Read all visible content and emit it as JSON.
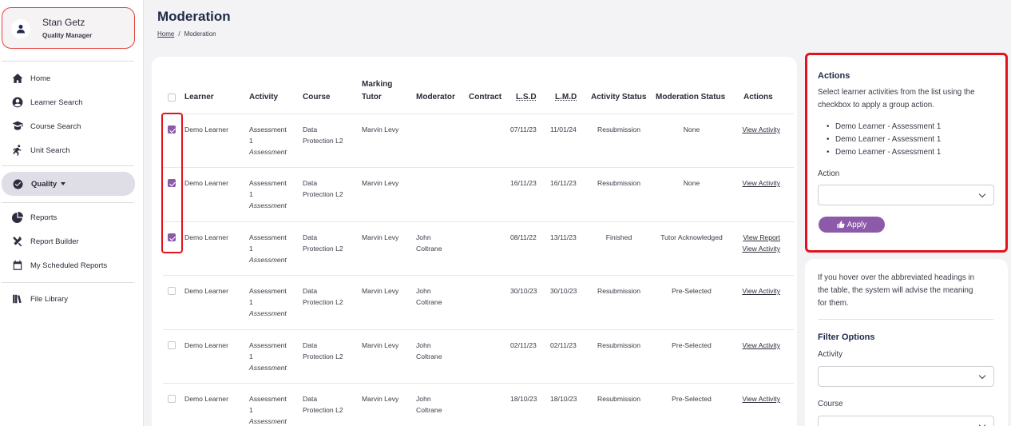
{
  "user": {
    "name": "Stan Getz",
    "role": "Quality Manager",
    "icon": "user-icon"
  },
  "nav": {
    "home": "Home",
    "learner_search": "Learner Search",
    "course_search": "Course Search",
    "unit_search": "Unit Search",
    "quality": "Quality",
    "reports": "Reports",
    "report_builder": "Report Builder",
    "scheduled_reports": "My Scheduled Reports",
    "file_library": "File Library"
  },
  "page": {
    "title": "Moderation",
    "breadcrumb_home": "Home",
    "breadcrumb_current": "Moderation"
  },
  "table": {
    "headers": {
      "learner": "Learner",
      "activity": "Activity",
      "course": "Course",
      "marking_tutor_1": "Marking",
      "marking_tutor_2": "Tutor",
      "moderator": "Moderator",
      "contract": "Contract",
      "lsd": "L.S.D",
      "lmd": "L.M.D",
      "activity_status": "Activity Status",
      "moderation_status": "Moderation Status",
      "actions": "Actions"
    },
    "rows": [
      {
        "checked": true,
        "learner": "Demo Learner",
        "activity_1": "Assessment",
        "activity_2": "1",
        "activity_type": "Assessment",
        "course_1": "Data",
        "course_2": "Protection L2",
        "tutor": "Marvin Levy",
        "moderator_1": "",
        "moderator_2": "",
        "lsd": "07/11/23",
        "lmd": "11/01/24",
        "activity_status": "Resubmission",
        "moderation_status": "None",
        "action_1": "View Activity",
        "action_2": ""
      },
      {
        "checked": true,
        "learner": "Demo Learner",
        "activity_1": "Assessment",
        "activity_2": "1",
        "activity_type": "Assessment",
        "course_1": "Data",
        "course_2": "Protection L2",
        "tutor": "Marvin Levy",
        "moderator_1": "",
        "moderator_2": "",
        "lsd": "16/11/23",
        "lmd": "16/11/23",
        "activity_status": "Resubmission",
        "moderation_status": "None",
        "action_1": "View Activity",
        "action_2": ""
      },
      {
        "checked": true,
        "learner": "Demo Learner",
        "activity_1": "Assessment",
        "activity_2": "1",
        "activity_type": "Assessment",
        "course_1": "Data",
        "course_2": "Protection L2",
        "tutor": "Marvin Levy",
        "moderator_1": "John",
        "moderator_2": "Coltrane",
        "lsd": "08/11/22",
        "lmd": "13/11/23",
        "activity_status": "Finished",
        "moderation_status": "Tutor Acknowledged",
        "action_1": "View Report",
        "action_2": "View Activity"
      },
      {
        "checked": false,
        "learner": "Demo Learner",
        "activity_1": "Assessment",
        "activity_2": "1",
        "activity_type": "Assessment",
        "course_1": "Data",
        "course_2": "Protection L2",
        "tutor": "Marvin Levy",
        "moderator_1": "John",
        "moderator_2": "Coltrane",
        "lsd": "30/10/23",
        "lmd": "30/10/23",
        "activity_status": "Resubmission",
        "moderation_status": "Pre-Selected",
        "action_1": "View Activity",
        "action_2": ""
      },
      {
        "checked": false,
        "learner": "Demo Learner",
        "activity_1": "Assessment",
        "activity_2": "1",
        "activity_type": "Assessment",
        "course_1": "Data",
        "course_2": "Protection L2",
        "tutor": "Marvin Levy",
        "moderator_1": "John",
        "moderator_2": "Coltrane",
        "lsd": "02/11/23",
        "lmd": "02/11/23",
        "activity_status": "Resubmission",
        "moderation_status": "Pre-Selected",
        "action_1": "View Activity",
        "action_2": ""
      },
      {
        "checked": false,
        "learner": "Demo Learner",
        "activity_1": "Assessment",
        "activity_2": "1",
        "activity_type": "Assessment",
        "course_1": "Data",
        "course_2": "Protection L2",
        "tutor": "Marvin Levy",
        "moderator_1": "John",
        "moderator_2": "Coltrane",
        "lsd": "18/10/23",
        "lmd": "18/10/23",
        "activity_status": "Resubmission",
        "moderation_status": "Pre-Selected",
        "action_1": "View Activity",
        "action_2": ""
      }
    ]
  },
  "actions_panel": {
    "title": "Actions",
    "desc_1": "Select learner activities from the list using the",
    "desc_2": "checkbox to apply a group action.",
    "selected": [
      "Demo Learner - Assessment 1",
      "Demo Learner - Assessment 1",
      "Demo Learner - Assessment 1"
    ],
    "action_label": "Action",
    "action_value": "",
    "apply_label": "Apply"
  },
  "filter_panel": {
    "hint_1": "If you hover over the abbreviated headings in",
    "hint_2": "the table, the system will advise the meaning",
    "hint_3": "for them.",
    "title": "Filter Options",
    "activity_label": "Activity",
    "activity_value": "",
    "course_label": "Course",
    "course_value": ""
  },
  "colors": {
    "accent": "#8c5aa8",
    "highlight": "#e3121d",
    "title": "#1f2a4a",
    "user_card_border": "#e8403a"
  }
}
